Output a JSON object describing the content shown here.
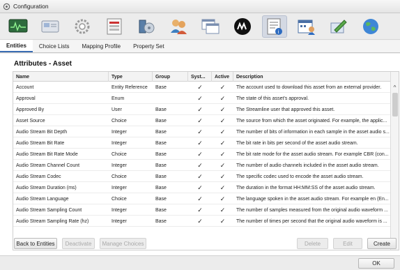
{
  "window": {
    "title": "Configuration"
  },
  "toolbar": {
    "icons": [
      "monitor-icon",
      "server-icon",
      "gear-icon",
      "form-icon",
      "storage-icon",
      "users-icon",
      "windows-icon",
      "logo-icon",
      "attributes-icon",
      "calendar-user-icon",
      "edit-icon",
      "globe-icon"
    ],
    "active_index": 8
  },
  "tabs": [
    {
      "label": "Entities",
      "selected": true
    },
    {
      "label": "Choice Lists",
      "selected": false
    },
    {
      "label": "Mapping Profile",
      "selected": false
    },
    {
      "label": "Property Set",
      "selected": false
    }
  ],
  "panel": {
    "heading": "Attributes - Asset"
  },
  "table": {
    "columns": [
      "Name",
      "Type",
      "Group",
      "Syst...",
      "Active",
      "Description"
    ],
    "rows": [
      {
        "name": "Account",
        "type": "Entity Reference",
        "group": "Base",
        "system": "✓",
        "active": "✓",
        "description": "The account used to download this asset from an external provider."
      },
      {
        "name": "Approval",
        "type": "Enum",
        "group": "",
        "system": "✓",
        "active": "✓",
        "description": "The state of this asset's approval."
      },
      {
        "name": "Approved By",
        "type": "User",
        "group": "Base",
        "system": "✓",
        "active": "✓",
        "description": "The Streamline user that approved this asset."
      },
      {
        "name": "Asset Source",
        "type": "Choice",
        "group": "Base",
        "system": "✓",
        "active": "✓",
        "description": "The source from which the asset originated. For example, the applic..."
      },
      {
        "name": "Audio Stream Bit Depth",
        "type": "Integer",
        "group": "Base",
        "system": "✓",
        "active": "✓",
        "description": "The number of bits of information in each sample in the asset audio s..."
      },
      {
        "name": "Audio Stream Bit Rate",
        "type": "Integer",
        "group": "Base",
        "system": "✓",
        "active": "✓",
        "description": "The bit rate in bits per second of the asset audio stream."
      },
      {
        "name": "Audio Stream Bit Rate Mode",
        "type": "Choice",
        "group": "Base",
        "system": "✓",
        "active": "✓",
        "description": "The bit rate mode for the asset audio stream. For example CBR (con..."
      },
      {
        "name": "Audio Stream Channel Count",
        "type": "Integer",
        "group": "Base",
        "system": "✓",
        "active": "✓",
        "description": "The number of audio channels included in the asset audio stream."
      },
      {
        "name": "Audio Stream Codec",
        "type": "Choice",
        "group": "Base",
        "system": "✓",
        "active": "✓",
        "description": "The specific codec used to encode the asset audio stream."
      },
      {
        "name": "Audio Stream Duration (ms)",
        "type": "Integer",
        "group": "Base",
        "system": "✓",
        "active": "✓",
        "description": "The duration in the format HH:MM:SS of the asset audio stream."
      },
      {
        "name": "Audio Stream Language",
        "type": "Choice",
        "group": "Base",
        "system": "✓",
        "active": "✓",
        "description": "The language spoken in the asset audio stream. For example en (En..."
      },
      {
        "name": "Audio Stream Sampling Count",
        "type": "Integer",
        "group": "Base",
        "system": "✓",
        "active": "✓",
        "description": "The number of samples measured from the original audio waveform ..."
      },
      {
        "name": "Audio Stream Sampling Rate (hz)",
        "type": "Integer",
        "group": "Base",
        "system": "✓",
        "active": "✓",
        "description": "The number of times per second that the original audio waveform is ..."
      }
    ]
  },
  "buttons": {
    "back": "Back to Entities",
    "deactivate": "Deactivate",
    "manage_choices": "Manage Choices",
    "delete": "Delete",
    "edit": "Edit",
    "create": "Create"
  },
  "footer": {
    "ok": "OK"
  },
  "scroll": {
    "up": "^",
    "down": "v"
  }
}
